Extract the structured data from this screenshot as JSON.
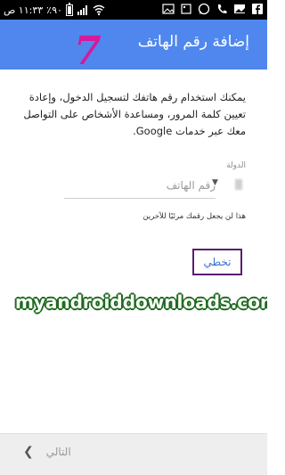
{
  "status_bar": {
    "clock": "١١:٣٣ ص",
    "battery": "٪٩٠",
    "icons_left": [
      "battery-icon",
      "signal-icon",
      "wifi-icon"
    ],
    "icons_right": [
      "facebook-icon",
      "image-icon",
      "whatsapp-icon",
      "phone-icon",
      "gallery-icon",
      "app-icon"
    ]
  },
  "app_bar": {
    "title": "إضافة رقم الهاتف",
    "step_number": "7",
    "background": "#4f87ee",
    "step_color": "#d6199a"
  },
  "intro_text": "يمكنك استخدام رقم هاتفك لتسجيل الدخول، وإعادة تعيين كلمة المرور، ومساعدة الأشخاص على التواصل معك عبر خدمات Google.",
  "country": {
    "label": "الدولة"
  },
  "phone": {
    "placeholder": "رقم الهاتف",
    "value": ""
  },
  "hint": "هذا لن يجعل رقمك مرئيًا للآخرين",
  "skip": {
    "label": "تخطي",
    "highlight_color": "#5b1e72"
  },
  "watermark": "myandroiddownloads.com",
  "footer": {
    "next_label": "التالي"
  }
}
